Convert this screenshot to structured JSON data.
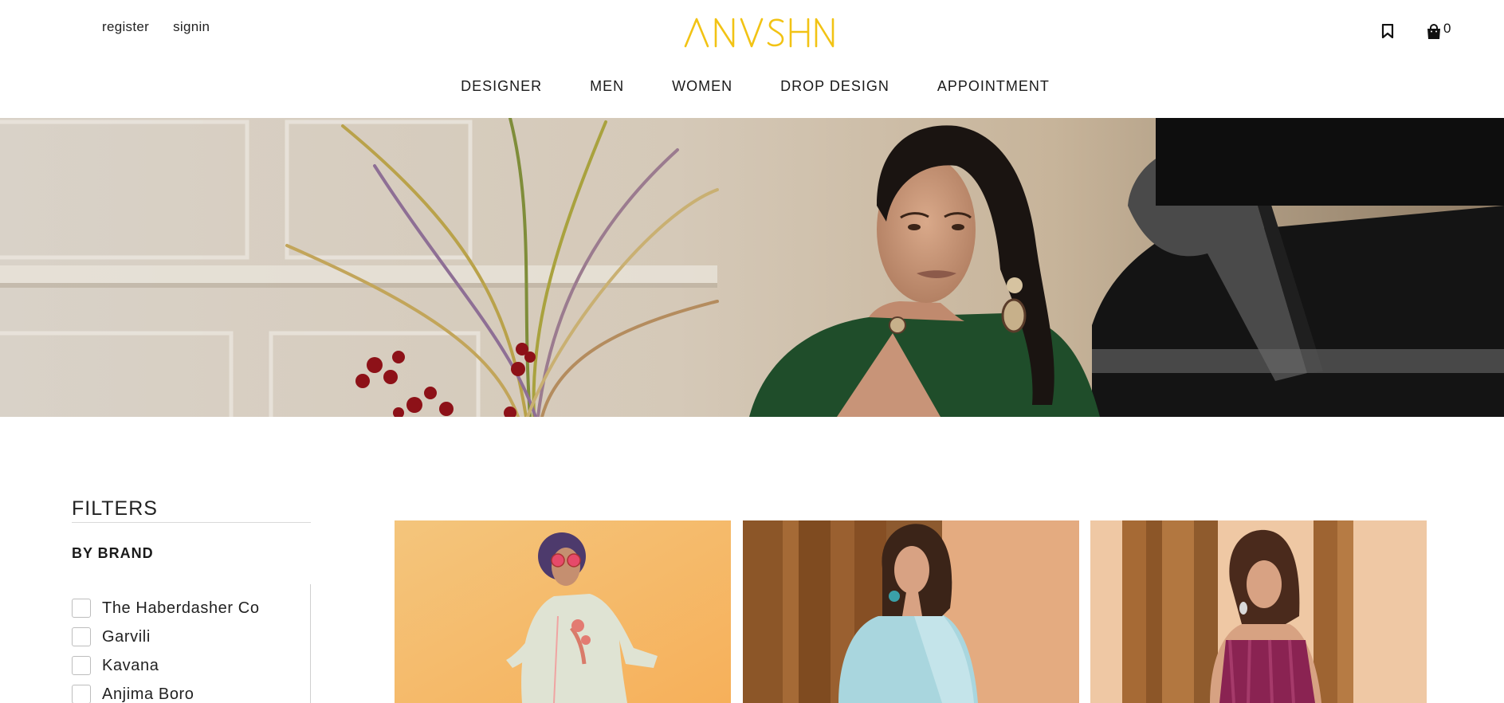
{
  "header": {
    "register_label": "register",
    "signin_label": "signin",
    "logo_text": "ANVSHN",
    "cart_count": "0",
    "brand_color": "#F2C314"
  },
  "nav": {
    "items": [
      "DESIGNER",
      "MEN",
      "WOMEN",
      "DROP DESIGN",
      "APPOINTMENT"
    ]
  },
  "filters": {
    "title": "FILTERS",
    "group_title": "BY BRAND",
    "brands": [
      "The Haberdasher Co",
      "Garvili",
      "Kavana",
      "Anjima Boro"
    ]
  },
  "icons": {
    "bookmark": "bookmark-icon",
    "cart": "shopping-bag-icon"
  }
}
